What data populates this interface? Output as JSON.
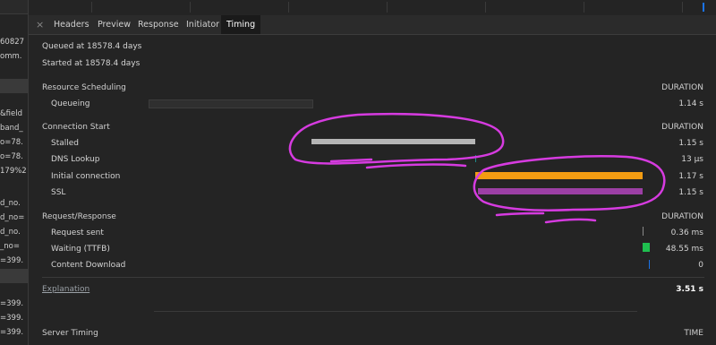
{
  "left_list": {
    "fragments": [
      "60827",
      "omm.",
      "&field",
      "band_",
      "o=78.",
      "o=78.",
      "179%2",
      "d_no.",
      "d_no=",
      "d_no.",
      "_no=",
      "=399.",
      "=399.",
      "=399.",
      "=399."
    ]
  },
  "tabs": [
    "Headers",
    "Preview",
    "Response",
    "Initiator",
    "Timing"
  ],
  "active_tab": "Timing",
  "info": {
    "queued": "Queued at 18578.4 days",
    "started": "Started at 18578.4 days"
  },
  "sections": {
    "resource_scheduling": {
      "title": "Resource Scheduling",
      "header": "DURATION",
      "rows": [
        {
          "label": "Queueing",
          "duration": "1.14 s"
        }
      ]
    },
    "connection_start": {
      "title": "Connection Start",
      "header": "DURATION",
      "rows": [
        {
          "label": "Stalled",
          "duration": "1.15 s"
        },
        {
          "label": "DNS Lookup",
          "duration": "13 µs"
        },
        {
          "label": "Initial connection",
          "duration": "1.17 s"
        },
        {
          "label": "SSL",
          "duration": "1.15 s"
        }
      ]
    },
    "request_response": {
      "title": "Request/Response",
      "header": "DURATION",
      "rows": [
        {
          "label": "Request sent",
          "duration": "0.36 ms"
        },
        {
          "label": "Waiting (TTFB)",
          "duration": "48.55 ms"
        },
        {
          "label": "Content Download",
          "duration": "0"
        }
      ]
    }
  },
  "explanation": {
    "label": "Explanation",
    "total": "3.51 s"
  },
  "server_timing": {
    "title": "Server Timing",
    "header": "TIME"
  },
  "colors": {
    "queueing": "#2f2f2f",
    "stalled": "#b5b5b5",
    "dns": "#1e8a8a",
    "initial": "#f39c12",
    "ssl": "#9c3fa5",
    "request": "#8a8a8a",
    "ttfb": "#1fbf4f",
    "download": "#1a73e8",
    "annotation": "#d63be0"
  }
}
